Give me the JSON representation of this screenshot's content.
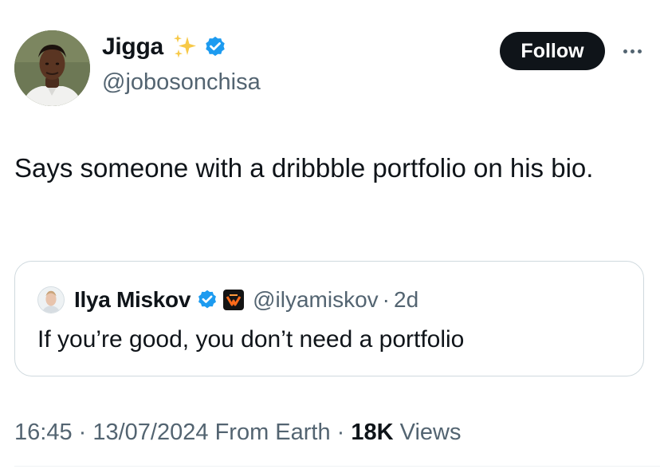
{
  "author": {
    "name": "Jigga",
    "handle": "@jobosonchisa",
    "avatar_icon": "user-avatar",
    "sparkles_icon": "sparkles-icon",
    "verified_icon": "verified-badge-icon"
  },
  "actions": {
    "follow_label": "Follow",
    "more_icon": "more-options-icon"
  },
  "tweet": {
    "text": "Says someone with a dribbble portfolio on his bio."
  },
  "quote": {
    "name": "Ilya Miskov",
    "handle": "@ilyamiskov",
    "separator": "·",
    "time": "2d",
    "text": "If you’re good, you don’t need a portfolio",
    "verified_icon": "verified-badge-icon",
    "affiliate_icon": "affiliate-badge-icon"
  },
  "meta": {
    "time": "16:45",
    "sep1": " · ",
    "date": "13/07/2024",
    "location": " From Earth",
    "sep2": " · ",
    "views_count": "18K",
    "views_label": " Views"
  },
  "colors": {
    "text_primary": "#0f1419",
    "text_secondary": "#536471",
    "verified_blue": "#1d9bf0",
    "follow_bg": "#0f1419",
    "border": "#cfd9de"
  }
}
